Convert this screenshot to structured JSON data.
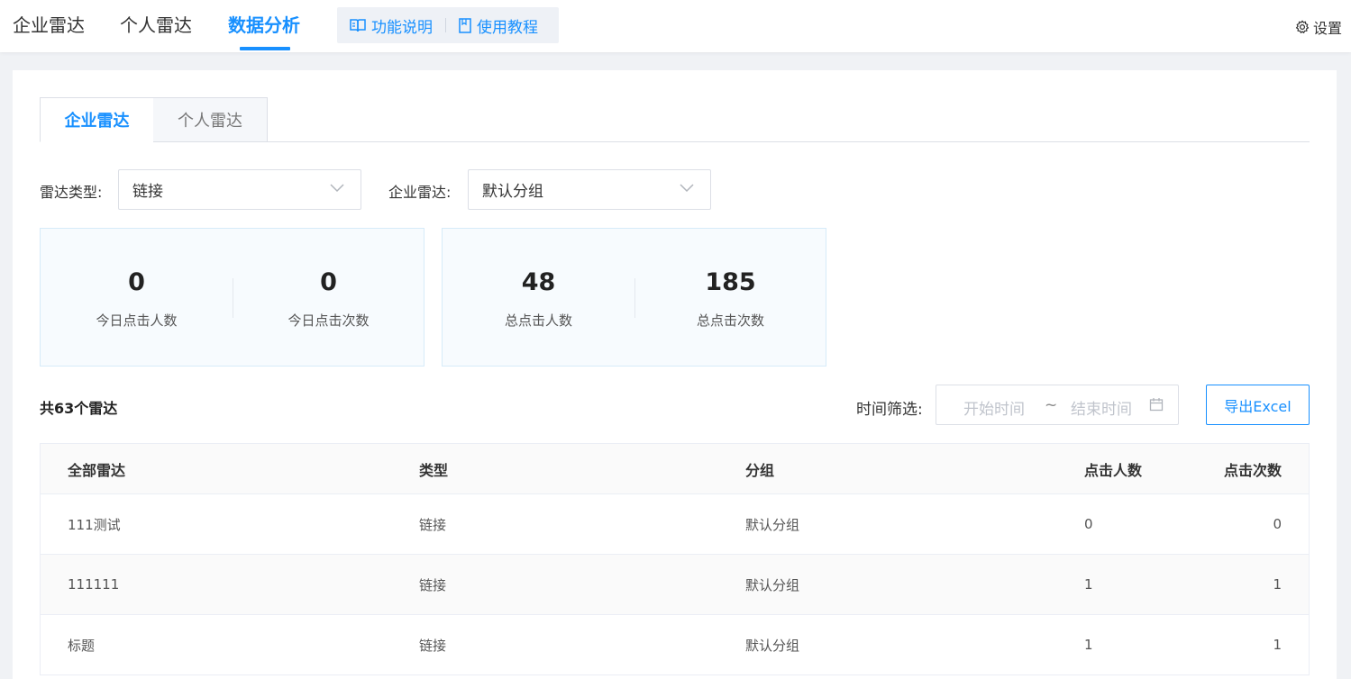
{
  "topnav": {
    "items": [
      {
        "label": "企业雷达"
      },
      {
        "label": "个人雷达"
      },
      {
        "label": "数据分析"
      }
    ],
    "help_links": [
      {
        "label": "功能说明",
        "icon": "book-icon"
      },
      {
        "label": "使用教程",
        "icon": "document-icon"
      }
    ],
    "settings_label": "设置"
  },
  "tabs": [
    {
      "label": "企业雷达",
      "active": true
    },
    {
      "label": "个人雷达",
      "active": false
    }
  ],
  "filters": {
    "radar_type_label": "雷达类型:",
    "radar_type_value": "链接",
    "enterprise_radar_label": "企业雷达:",
    "enterprise_radar_value": "默认分组"
  },
  "stats": {
    "today": [
      {
        "value": "0",
        "label": "今日点击人数"
      },
      {
        "value": "0",
        "label": "今日点击次数"
      }
    ],
    "total": [
      {
        "value": "48",
        "label": "总点击人数"
      },
      {
        "value": "185",
        "label": "总点击次数"
      }
    ]
  },
  "list": {
    "summary": "共63个雷达",
    "time_filter_label": "时间筛选:",
    "start_placeholder": "开始时间",
    "range_separator": "~",
    "end_placeholder": "结束时间",
    "export_label": "导出Excel"
  },
  "table": {
    "columns": [
      "全部雷达",
      "类型",
      "分组",
      "点击人数",
      "点击次数"
    ],
    "rows": [
      [
        "111测试",
        "链接",
        "默认分组",
        "0",
        "0"
      ],
      [
        "111111",
        "链接",
        "默认分组",
        "1",
        "1"
      ],
      [
        "标题",
        "链接",
        "默认分组",
        "1",
        "1"
      ]
    ]
  },
  "colors": {
    "accent": "#1890ff",
    "stat_bg": "#f7fbfe",
    "page_bg": "#f0f2f5"
  }
}
